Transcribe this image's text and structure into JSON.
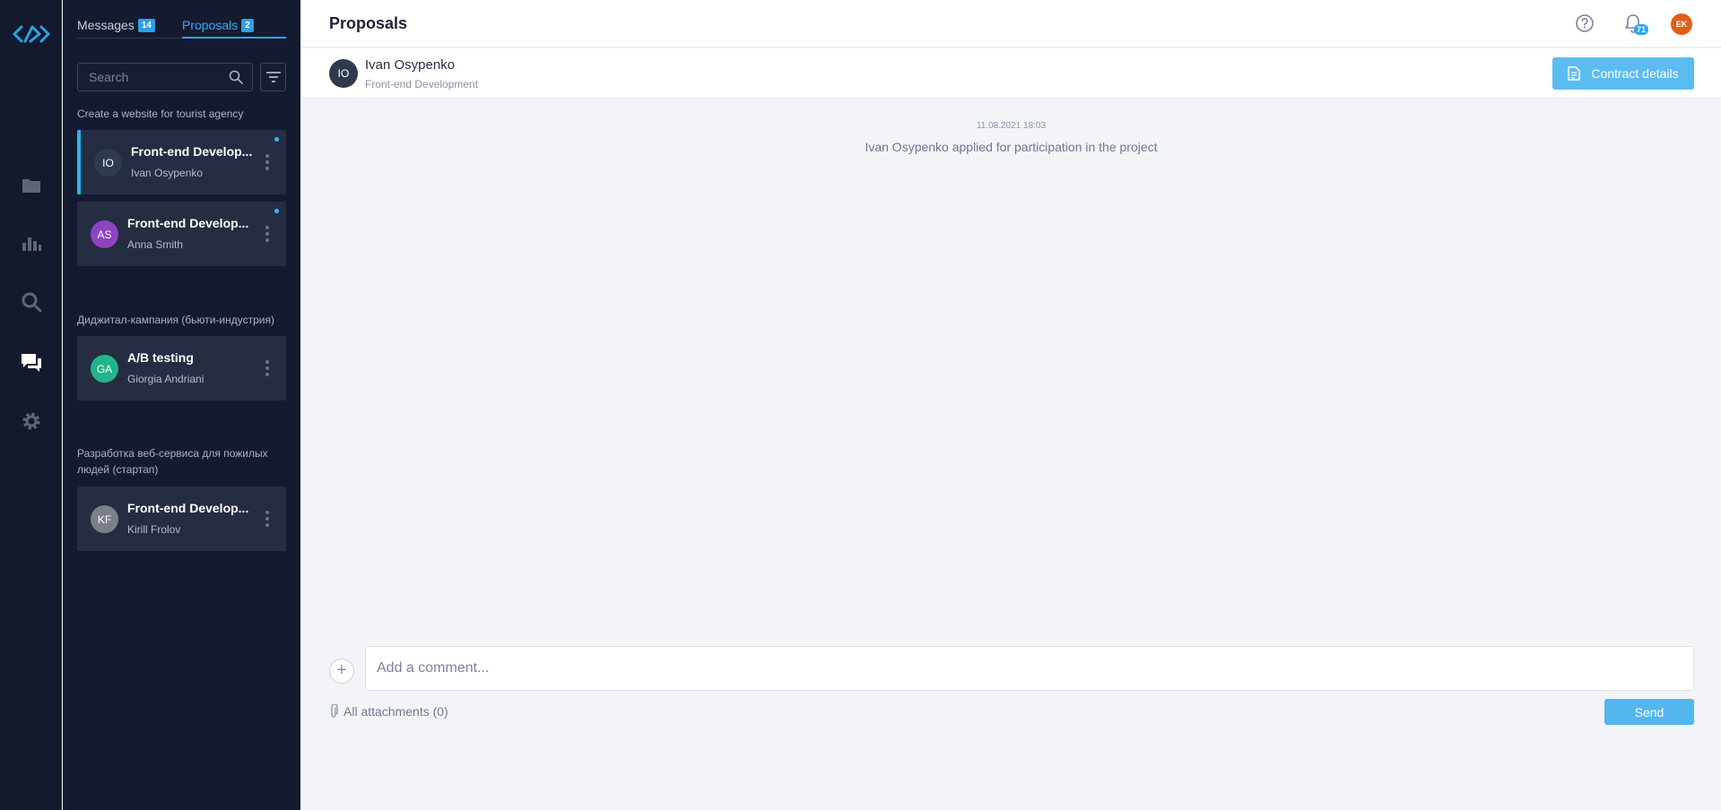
{
  "sidebar": {
    "tabs": [
      {
        "label": "Messages",
        "count": "14"
      },
      {
        "label": "Proposals",
        "count": "2"
      }
    ],
    "search_placeholder": "Search",
    "groups": [
      {
        "title": "Create a website for tourist agency",
        "items": [
          {
            "initials": "IO",
            "title": "Front-end Develop...",
            "subtitle": "Ivan Osypenko",
            "avatar_color": "#2f3a4e"
          },
          {
            "initials": "AS",
            "title": "Front-end Develop...",
            "subtitle": "Anna Smith",
            "avatar_color": "#8e44c0"
          }
        ]
      },
      {
        "title": "Диджитал-кампания (бьюти-индустрия)",
        "items": [
          {
            "initials": "GA",
            "title": "A/B testing",
            "subtitle": "Giorgia Andriani",
            "avatar_color": "#22b48a"
          }
        ]
      },
      {
        "title": "Разработка веб-сервиса для пожилых людей (стартап)",
        "items": [
          {
            "initials": "KF",
            "title": "Front-end Develop...",
            "subtitle": "Kirill Frolov",
            "avatar_color": "#7a8088"
          }
        ]
      }
    ]
  },
  "header": {
    "title": "Proposals",
    "notifications_count": "71",
    "user_initials": "EK"
  },
  "conversation": {
    "initials": "IO",
    "name": "Ivan Osypenko",
    "role": "Front-end Development",
    "contract_button": "Contract details",
    "date": "11.08.2021 18:03",
    "event_text": "Ivan Osypenko applied for participation in the project"
  },
  "composer": {
    "placeholder": "Add a comment...",
    "attachments_label": "All attachments (0)",
    "send_label": "Send"
  },
  "colors": {
    "accent": "#2ea6e8",
    "rail_bg": "#131a2e",
    "sidebar_bg": "#141b30",
    "card_bg": "#252d42",
    "button_bg": "#5bbcf0"
  }
}
